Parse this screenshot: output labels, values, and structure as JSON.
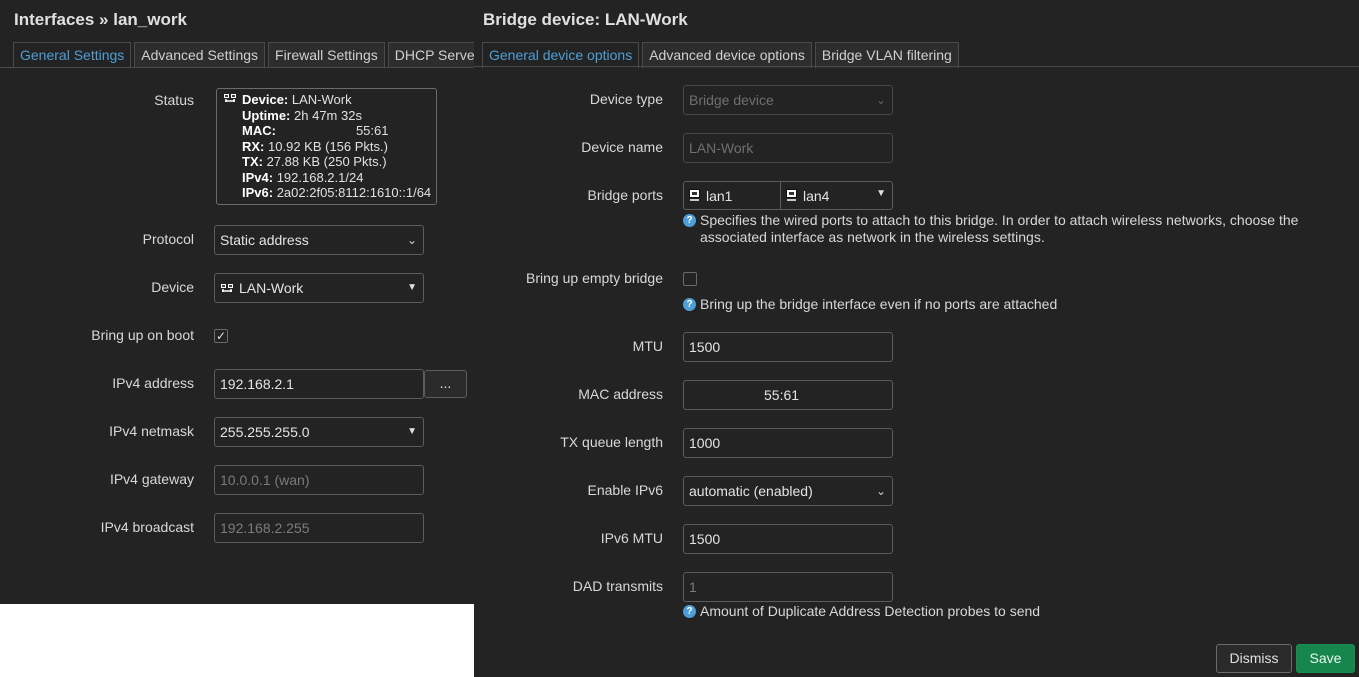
{
  "left": {
    "title": "Interfaces » lan_work",
    "tabs": [
      "General Settings",
      "Advanced Settings",
      "Firewall Settings",
      "DHCP Server"
    ],
    "status": {
      "label": "Status",
      "device_key": "Device:",
      "device_val": "LAN-Work",
      "uptime_key": "Uptime:",
      "uptime_val": "2h 47m 32s",
      "mac_key": "MAC:",
      "mac_val": "55:61",
      "rx_key": "RX:",
      "rx_val": "10.92 KB (156 Pkts.)",
      "tx_key": "TX:",
      "tx_val": "27.88 KB (250 Pkts.)",
      "ipv4_key": "IPv4:",
      "ipv4_val": "192.168.2.1/24",
      "ipv6_key": "IPv6:",
      "ipv6_val": "2a02:2f05:8112:1610::1/64"
    },
    "protocol": {
      "label": "Protocol",
      "value": "Static address"
    },
    "device": {
      "label": "Device",
      "value": "LAN-Work"
    },
    "boot": {
      "label": "Bring up on boot",
      "checked": true
    },
    "ipv4_address": {
      "label": "IPv4 address",
      "value": "192.168.2.1",
      "button": "..."
    },
    "ipv4_netmask": {
      "label": "IPv4 netmask",
      "value": "255.255.255.0"
    },
    "ipv4_gateway": {
      "label": "IPv4 gateway",
      "placeholder": "10.0.0.1 (wan)"
    },
    "ipv4_broadcast": {
      "label": "IPv4 broadcast",
      "placeholder": "192.168.2.255"
    }
  },
  "right": {
    "title": "Bridge device: LAN-Work",
    "tabs": [
      "General device options",
      "Advanced device options",
      "Bridge VLAN filtering"
    ],
    "device_type": {
      "label": "Device type",
      "value": "Bridge device"
    },
    "device_name": {
      "label": "Device name",
      "value": "LAN-Work"
    },
    "bridge_ports": {
      "label": "Bridge ports",
      "ports": [
        "lan1",
        "lan4"
      ],
      "help": "Specifies the wired ports to attach to this bridge. In order to attach wireless networks, choose the associated interface as network in the wireless settings."
    },
    "empty_bridge": {
      "label": "Bring up empty bridge",
      "checked": false,
      "help": "Bring up the bridge interface even if no ports are attached"
    },
    "mtu": {
      "label": "MTU",
      "value": "1500"
    },
    "mac": {
      "label": "MAC address",
      "value": "55:61"
    },
    "txqueue": {
      "label": "TX queue length",
      "value": "1000"
    },
    "enable_ipv6": {
      "label": "Enable IPv6",
      "value": "automatic (enabled)"
    },
    "ipv6_mtu": {
      "label": "IPv6 MTU",
      "value": "1500"
    },
    "dad": {
      "label": "DAD transmits",
      "placeholder": "1",
      "help": "Amount of Duplicate Address Detection probes to send"
    },
    "dismiss": "Dismiss",
    "save": "Save"
  }
}
